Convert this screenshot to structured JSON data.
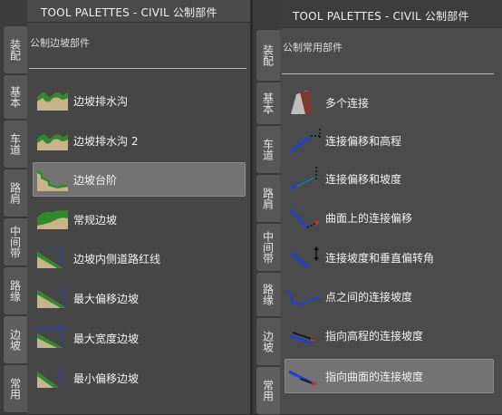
{
  "left_palette": {
    "title": "TOOL PALETTES - CIVIL 公制部件",
    "tabs": [
      "装配",
      "基本",
      "车道",
      "路肩",
      "中间带",
      "路缘",
      "边坡",
      "常用"
    ],
    "active_tab": "边坡",
    "section": "公制边坡部件",
    "items": [
      {
        "label": "边坡排水沟",
        "icon": "slope-ditch-icon"
      },
      {
        "label": "边坡排水沟 2",
        "icon": "slope-ditch-2-icon"
      },
      {
        "label": "边坡台阶",
        "icon": "slope-bench-icon",
        "selected": true
      },
      {
        "label": "常规边坡",
        "icon": "basic-slope-icon"
      },
      {
        "label": "边坡内侧道路红线",
        "icon": "slope-row-icon"
      },
      {
        "label": "最大偏移边坡",
        "icon": "max-offset-slope-icon"
      },
      {
        "label": "最大宽度边坡",
        "icon": "max-width-slope-icon"
      },
      {
        "label": "最小偏移边坡",
        "icon": "min-offset-slope-icon"
      }
    ]
  },
  "right_palette": {
    "title": "TOOL PALETTES - CIVIL 公制部件",
    "tabs": [
      "装配",
      "基本",
      "车道",
      "路肩",
      "中间带",
      "路缘",
      "边坡",
      "常用"
    ],
    "active_tab": "常用",
    "section": "公制常用部件",
    "items": [
      {
        "label": "多个连接",
        "icon": "multiple-links-icon"
      },
      {
        "label": "连接偏移和高程",
        "icon": "link-offset-elevation-icon"
      },
      {
        "label": "连接偏移和坡度",
        "icon": "link-offset-slope-icon"
      },
      {
        "label": "曲面上的连接偏移",
        "icon": "link-offset-on-surface-icon"
      },
      {
        "label": "连接坡度和垂直偏转角",
        "icon": "link-slope-vertical-deflection-icon"
      },
      {
        "label": "点之间的连接坡度",
        "icon": "link-slope-between-points-icon"
      },
      {
        "label": "指向高程的连接坡度",
        "icon": "link-slope-to-elevation-icon"
      },
      {
        "label": "指向曲面的连接坡度",
        "icon": "link-slope-to-surface-icon",
        "selected": true
      }
    ]
  },
  "colors": {
    "slope_green": "#2f8a2a",
    "soil_tan": "#c8b48a",
    "link_blue": "#1f3fd6",
    "rock_brown": "#7a3b2a"
  }
}
